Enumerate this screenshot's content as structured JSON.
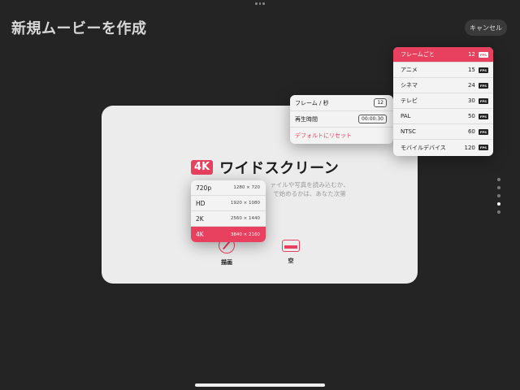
{
  "header": {
    "title": "新規ムービーを作成",
    "cancel_label": "キャンセル"
  },
  "card": {
    "badge": "4K",
    "title": "ワイドスクリーン",
    "description_lines": [
      "すぐ　　　　　　　　　　ァイルや写真を読み込むか、",
      "ま　　　　　　　　　　　で始めるかは、あなた次第"
    ],
    "modes": [
      {
        "label": "描画",
        "icon": "draw-icon"
      },
      {
        "label": "空",
        "icon": "empty-canvas-icon"
      }
    ]
  },
  "resolution_menu": {
    "items": [
      {
        "label": "720p",
        "dims": "1280 × 720",
        "selected": false
      },
      {
        "label": "HD",
        "dims": "1920 × 1080",
        "selected": false
      },
      {
        "label": "2K",
        "dims": "2560 × 1440",
        "selected": false
      },
      {
        "label": "4K",
        "dims": "3840 × 2160",
        "selected": true
      }
    ]
  },
  "settings_menu": {
    "frame_rate_label": "フレーム / 秒",
    "frame_rate_value": "12",
    "duration_label": "再生時間",
    "duration_value": "00:00:30",
    "reset_label": "デフォルトにリセット"
  },
  "fps_menu": {
    "tag": "FPS",
    "items": [
      {
        "label": "フレームごと",
        "value": "12",
        "selected": true
      },
      {
        "label": "アニメ",
        "value": "15",
        "selected": false
      },
      {
        "label": "シネマ",
        "value": "24",
        "selected": false
      },
      {
        "label": "テレビ",
        "value": "30",
        "selected": false
      },
      {
        "label": "PAL",
        "value": "50",
        "selected": false
      },
      {
        "label": "NTSC",
        "value": "60",
        "selected": false
      },
      {
        "label": "モバイルデバイス",
        "value": "120",
        "selected": false
      }
    ]
  },
  "page_indicator": {
    "count": 5,
    "active_index": 3
  },
  "colors": {
    "accent": "#e8415f",
    "background": "#242424",
    "card": "#ececec"
  }
}
